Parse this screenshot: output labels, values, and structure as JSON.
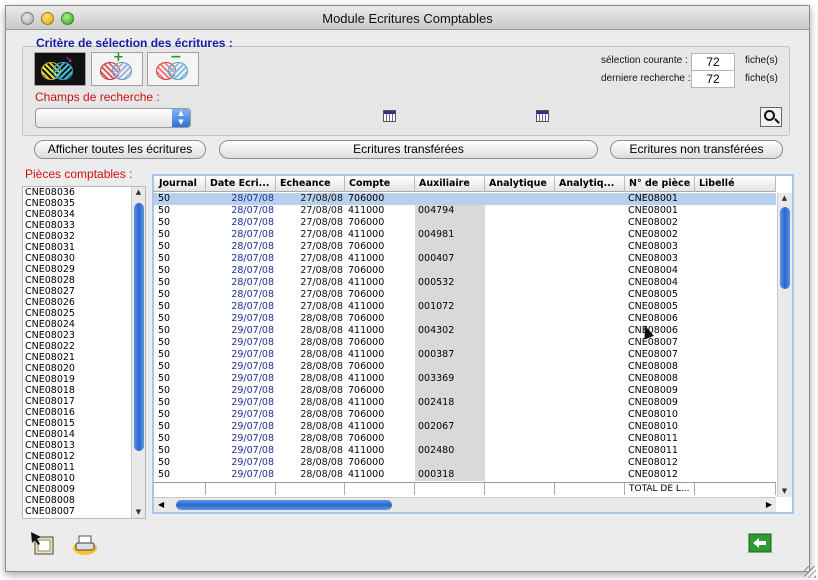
{
  "window": {
    "title": "Module Ecritures Comptables"
  },
  "criteria": {
    "heading": "Critère de sélection des écritures :",
    "selection_label": "sélection courante :",
    "selection_value": "72",
    "selection_unit": "fiche(s)",
    "last_search_label": "derniere recherche :",
    "last_search_value": "72",
    "last_search_unit": "fiche(s)"
  },
  "search": {
    "heading": "Champs de recherche :",
    "field_value": ""
  },
  "buttons": {
    "show_all": "Afficher toutes les écritures",
    "transferred": "Ecritures transférées",
    "not_transferred": "Ecritures non transférées"
  },
  "pieces": {
    "heading": "Pièces comptables :",
    "items": [
      "CNE08036",
      "CNE08035",
      "CNE08034",
      "CNE08033",
      "CNE08032",
      "CNE08031",
      "CNE08030",
      "CNE08029",
      "CNE08028",
      "CNE08027",
      "CNE08026",
      "CNE08025",
      "CNE08024",
      "CNE08023",
      "CNE08022",
      "CNE08021",
      "CNE08020",
      "CNE08019",
      "CNE08018",
      "CNE08017",
      "CNE08016",
      "CNE08015",
      "CNE08014",
      "CNE08013",
      "CNE08012",
      "CNE08011",
      "CNE08010",
      "CNE08009",
      "CNE08008",
      "CNE08007"
    ]
  },
  "table": {
    "columns": [
      "Journal",
      "Date Ecri...",
      "Echeance",
      "Compte",
      "Auxiliaire",
      "Analytique",
      "Analytiq...",
      "N° de pièce",
      "Libellé"
    ],
    "rows": [
      [
        "50",
        "28/07/08",
        "27/08/08",
        "706000",
        "",
        "",
        "",
        "CNE08001",
        ""
      ],
      [
        "50",
        "28/07/08",
        "27/08/08",
        "411000",
        "004794",
        "",
        "",
        "CNE08001",
        ""
      ],
      [
        "50",
        "28/07/08",
        "27/08/08",
        "706000",
        "",
        "",
        "",
        "CNE08002",
        ""
      ],
      [
        "50",
        "28/07/08",
        "27/08/08",
        "411000",
        "004981",
        "",
        "",
        "CNE08002",
        ""
      ],
      [
        "50",
        "28/07/08",
        "27/08/08",
        "706000",
        "",
        "",
        "",
        "CNE08003",
        ""
      ],
      [
        "50",
        "28/07/08",
        "27/08/08",
        "411000",
        "000407",
        "",
        "",
        "CNE08003",
        ""
      ],
      [
        "50",
        "28/07/08",
        "27/08/08",
        "706000",
        "",
        "",
        "",
        "CNE08004",
        ""
      ],
      [
        "50",
        "28/07/08",
        "27/08/08",
        "411000",
        "000532",
        "",
        "",
        "CNE08004",
        ""
      ],
      [
        "50",
        "28/07/08",
        "27/08/08",
        "706000",
        "",
        "",
        "",
        "CNE08005",
        ""
      ],
      [
        "50",
        "28/07/08",
        "27/08/08",
        "411000",
        "001072",
        "",
        "",
        "CNE08005",
        ""
      ],
      [
        "50",
        "29/07/08",
        "28/08/08",
        "706000",
        "",
        "",
        "",
        "CNE08006",
        ""
      ],
      [
        "50",
        "29/07/08",
        "28/08/08",
        "411000",
        "004302",
        "",
        "",
        "CNE08006",
        ""
      ],
      [
        "50",
        "29/07/08",
        "28/08/08",
        "706000",
        "",
        "",
        "",
        "CNE08007",
        ""
      ],
      [
        "50",
        "29/07/08",
        "28/08/08",
        "411000",
        "000387",
        "",
        "",
        "CNE08007",
        ""
      ],
      [
        "50",
        "29/07/08",
        "28/08/08",
        "706000",
        "",
        "",
        "",
        "CNE08008",
        ""
      ],
      [
        "50",
        "29/07/08",
        "28/08/08",
        "411000",
        "003369",
        "",
        "",
        "CNE08008",
        ""
      ],
      [
        "50",
        "29/07/08",
        "28/08/08",
        "706000",
        "",
        "",
        "",
        "CNE08009",
        ""
      ],
      [
        "50",
        "29/07/08",
        "28/08/08",
        "411000",
        "002418",
        "",
        "",
        "CNE08009",
        ""
      ],
      [
        "50",
        "29/07/08",
        "28/08/08",
        "706000",
        "",
        "",
        "",
        "CNE08010",
        ""
      ],
      [
        "50",
        "29/07/08",
        "28/08/08",
        "411000",
        "002067",
        "",
        "",
        "CNE08010",
        ""
      ],
      [
        "50",
        "29/07/08",
        "28/08/08",
        "706000",
        "",
        "",
        "",
        "CNE08011",
        ""
      ],
      [
        "50",
        "29/07/08",
        "28/08/08",
        "411000",
        "002480",
        "",
        "",
        "CNE08011",
        ""
      ],
      [
        "50",
        "29/07/08",
        "28/08/08",
        "706000",
        "",
        "",
        "",
        "CNE08012",
        ""
      ],
      [
        "50",
        "29/07/08",
        "28/08/08",
        "411000",
        "000318",
        "",
        "",
        "CNE08012",
        ""
      ]
    ],
    "footer_total": "TOTAL DE L...",
    "selected_row": 0
  },
  "icons": {
    "selection_all": "venn-select-all-icon",
    "selection_add": "venn-add-icon",
    "selection_remove": "venn-remove-icon",
    "calendar": "calendar-icon",
    "search": "magnifier-icon",
    "edit": "edit-document-icon",
    "print": "printer-icon",
    "back": "back-arrow-icon"
  },
  "colors": {
    "accent_blue": "#1a1aa8",
    "label_red": "#d01010",
    "selection": "#b7d0ee",
    "date_text": "#1e2f98"
  }
}
